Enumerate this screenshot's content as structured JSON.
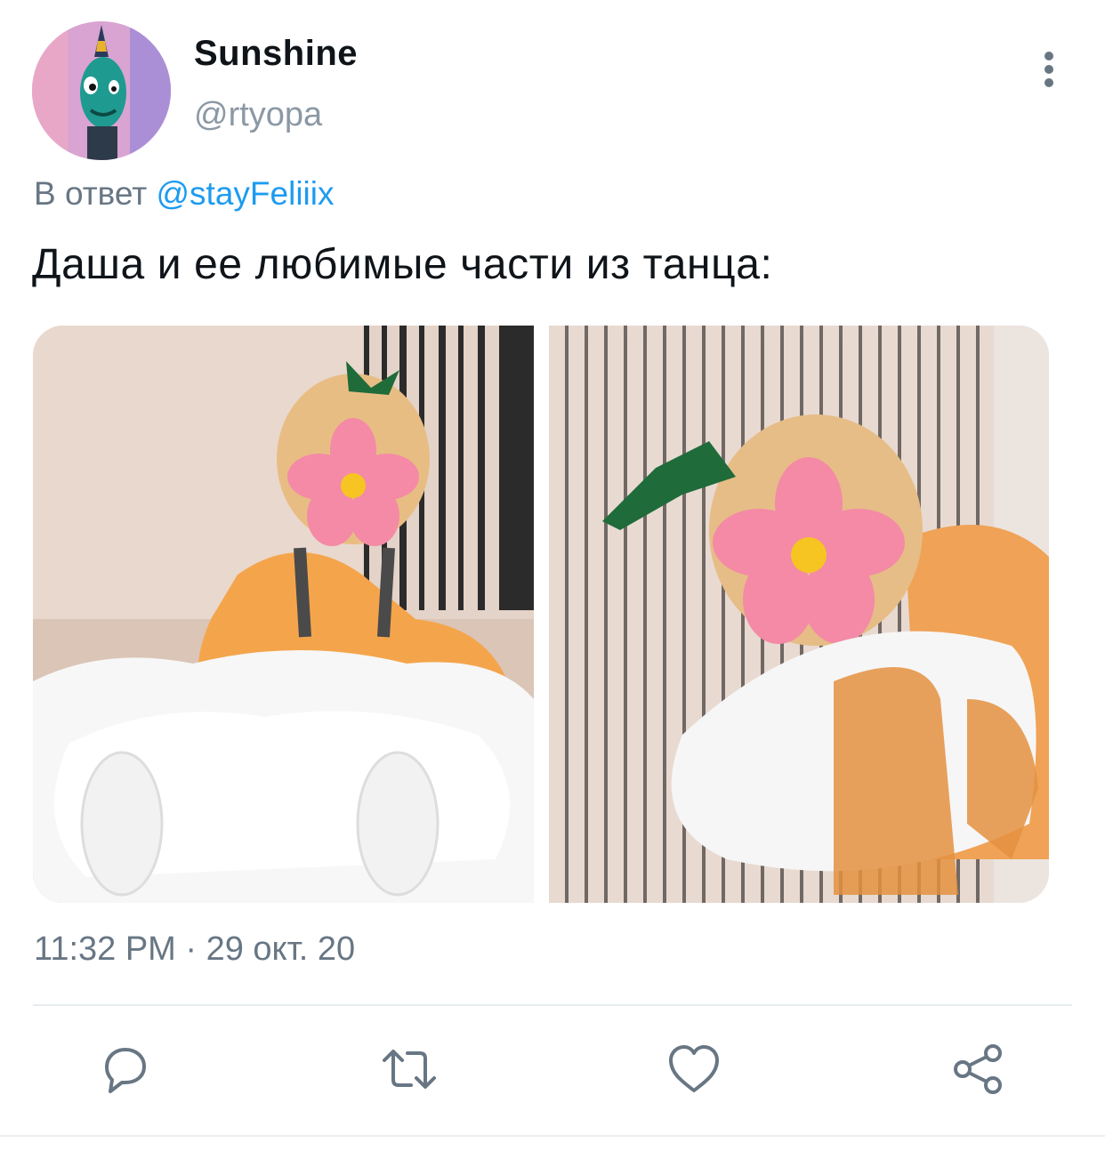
{
  "author": {
    "display_name": "Sunshine",
    "handle": "@rtyopa",
    "avatar_icon": "avatar-cartoon-fish-character"
  },
  "reply": {
    "prefix": "В ответ",
    "mention": "@stayFeliiix"
  },
  "tweet": {
    "text": "Даша и ее любимые части из танца:"
  },
  "media": [
    {
      "type": "photo"
    },
    {
      "type": "photo"
    }
  ],
  "timestamp": "11:32 PM · 29 окт. 20",
  "actions": [
    {
      "icon": "reply-icon"
    },
    {
      "icon": "retweet-icon"
    },
    {
      "icon": "like-icon"
    },
    {
      "icon": "share-icon"
    }
  ],
  "colors": {
    "link": "#1d9bf0",
    "secondary_text": "#687684",
    "icon": "#687684",
    "primary_text": "#0f1419"
  }
}
